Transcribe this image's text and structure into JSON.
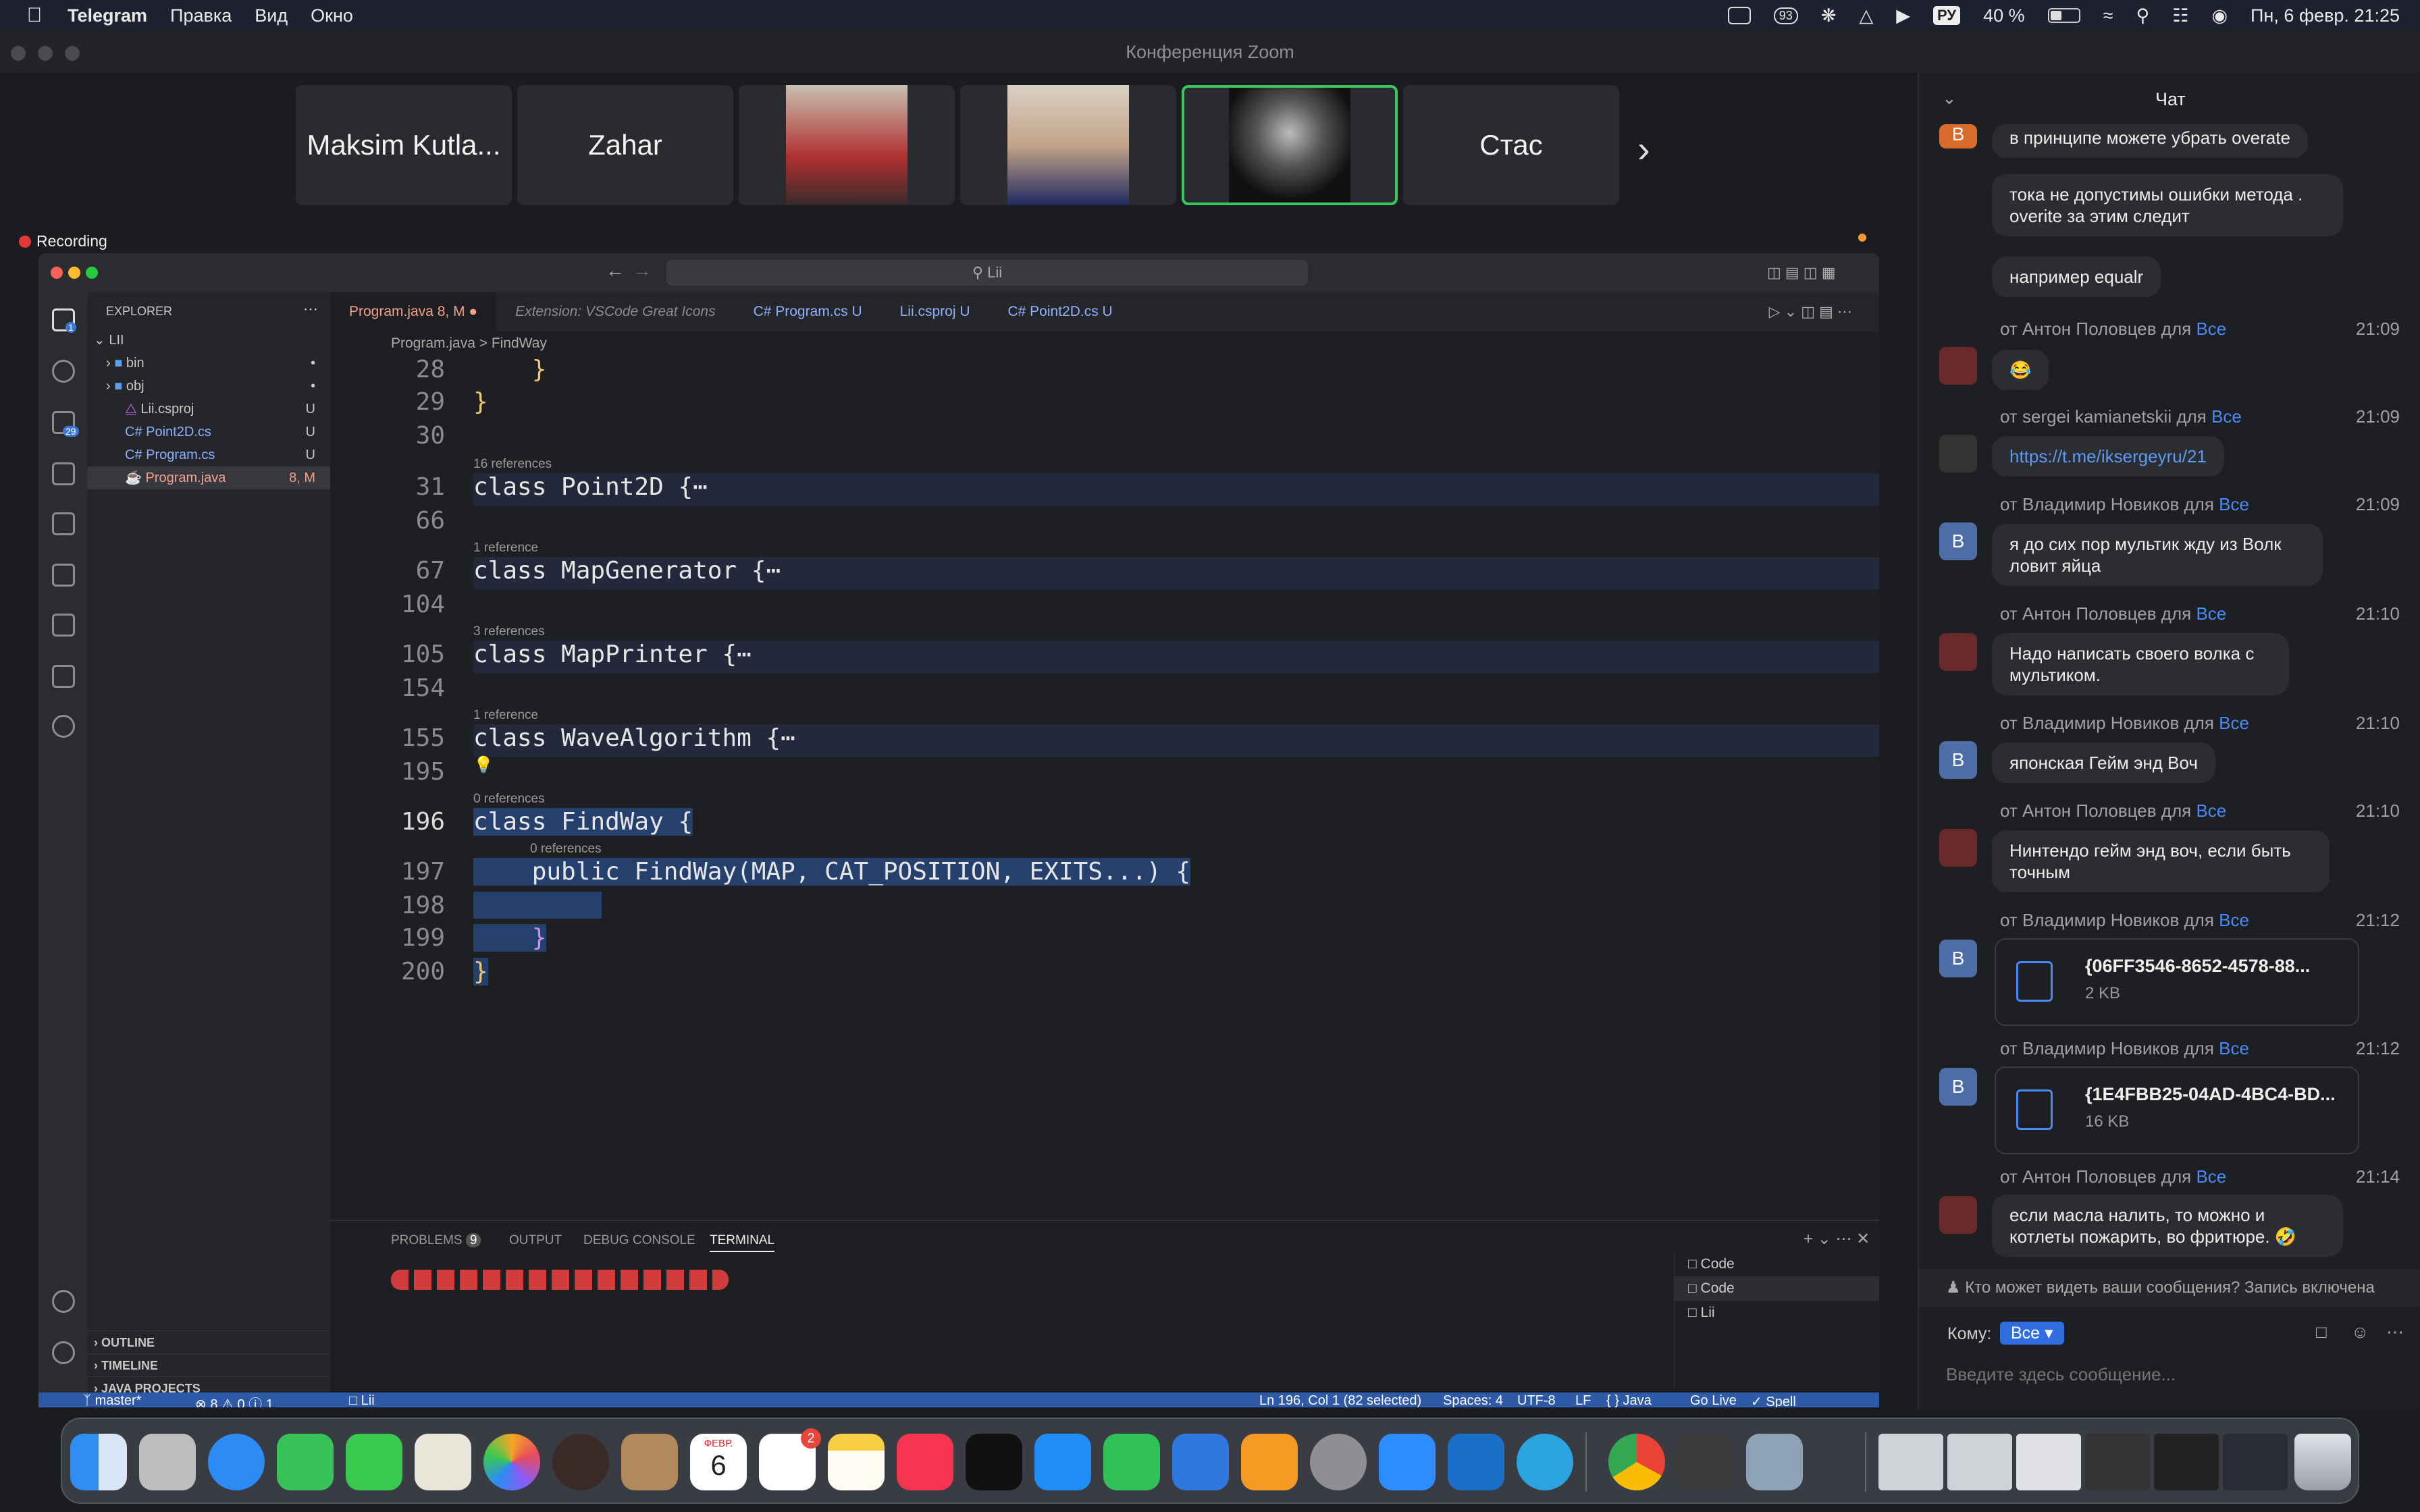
{
  "menubar": {
    "app": "Telegram",
    "items": [
      "Правка",
      "Вид",
      "Окно"
    ],
    "battery": "40 %",
    "lang": "РУ",
    "datetime": "Пн, 6 февр.  21:25",
    "badge": "93"
  },
  "zoom": {
    "title": "Конференция Zoom",
    "recording": "Recording",
    "participants": [
      "Maksim Kutla...",
      "Zahar",
      "",
      "",
      "",
      "Стас"
    ]
  },
  "vscode": {
    "search": "Lii",
    "explorer_title": "EXPLORER",
    "root": "LII",
    "files": [
      {
        "name": "bin",
        "status": "•"
      },
      {
        "name": "obj",
        "status": "•"
      },
      {
        "name": "Lii.csproj",
        "status": "U"
      },
      {
        "name": "Point2D.cs",
        "status": "U"
      },
      {
        "name": "Program.cs",
        "status": "U"
      },
      {
        "name": "Program.java",
        "status": "8, M"
      }
    ],
    "scm_badge": "29",
    "tabs": [
      {
        "label": "Program.java  8, M  ●"
      },
      {
        "label": "Extension: VSCode Great Icons"
      },
      {
        "label": "C# Program.cs  U"
      },
      {
        "label": "Lii.csproj  U"
      },
      {
        "label": "C# Point2D.cs  U"
      }
    ],
    "breadcrumb": "Program.java  >  FindWay",
    "lines": [
      {
        "n": "28",
        "code": "    }"
      },
      {
        "n": "29",
        "code": "}"
      },
      {
        "n": "30",
        "code": ""
      },
      {
        "n": "31",
        "refs": "16 references",
        "code": "class Point2D {⋯"
      },
      {
        "n": "66",
        "code": ""
      },
      {
        "n": "67",
        "refs": "1 reference",
        "code": "class MapGenerator {⋯"
      },
      {
        "n": "104",
        "code": ""
      },
      {
        "n": "105",
        "refs": "3 references",
        "code": "class MapPrinter {⋯"
      },
      {
        "n": "154",
        "code": ""
      },
      {
        "n": "155",
        "refs": "1 reference",
        "code": "class WaveAlgorithm {⋯"
      },
      {
        "n": "195",
        "code": ""
      },
      {
        "n": "196",
        "refs": "0 references",
        "code": "class FindWay {"
      },
      {
        "n": "197",
        "refs": "0 references",
        "code": "    public FindWay(MAP, CAT_POSITION, EXITS...) {"
      },
      {
        "n": "198",
        "code": ""
      },
      {
        "n": "199",
        "code": "    }"
      },
      {
        "n": "200",
        "code": "}"
      }
    ],
    "panel_tabs": [
      "PROBLEMS",
      "OUTPUT",
      "DEBUG CONSOLE",
      "TERMINAL"
    ],
    "problems_count": "9",
    "terminals": [
      "Code",
      "Code",
      "Lii"
    ],
    "outline": [
      "OUTLINE",
      "TIMELINE",
      "JAVA PROJECTS"
    ],
    "status": {
      "branch": "master*",
      "errors": "⊗ 8 ⚠ 0 ⓘ 1",
      "project": "Lii",
      "cursor": "Ln 196, Col 1 (82 selected)",
      "spaces": "Spaces: 4",
      "encoding": "UTF-8",
      "eol": "LF",
      "lang": "{ } Java",
      "golive": "Go Live",
      "spell": "✓ Spell"
    }
  },
  "chat": {
    "title": "Чат",
    "messages": [
      {
        "avatar": "В",
        "text": "в принципе можете убрать overate"
      },
      {
        "text": "тока не допустимы ошибки метода . overite за этим следит"
      },
      {
        "text": "например equalr"
      },
      {
        "from": "от Антон Половцев для",
        "to": "Все",
        "time": "21:09",
        "text": "😂"
      },
      {
        "from": "от sergei kamianetskii для",
        "to": "Все",
        "time": "21:09",
        "text": "https://t.me/iksergeyru/21"
      },
      {
        "from": "от Владимир Новиков для",
        "to": "Все",
        "time": "21:09",
        "avatar": "В",
        "text": "я до сих пор мультик жду из Волк ловит яйца"
      },
      {
        "from": "от Антон Половцев для",
        "to": "Все",
        "time": "21:10",
        "text": "Надо написать своего волка с мультиком."
      },
      {
        "from": "от Владимир Новиков для",
        "to": "Все",
        "time": "21:10",
        "avatar": "В",
        "text": "японская Гейм энд Воч"
      },
      {
        "from": "от Антон Половцев для",
        "to": "Все",
        "time": "21:10",
        "text": "Нинтендо гейм энд воч, если быть точным"
      },
      {
        "from": "от Владимир Новиков для",
        "to": "Все",
        "time": "21:12",
        "avatar": "В",
        "file": "{06FF3546-8652-4578-88...",
        "size": "2 KB"
      },
      {
        "from": "от Владимир Новиков для",
        "to": "Все",
        "time": "21:12",
        "avatar": "В",
        "file": "{1E4FBB25-04AD-4BC4-BD...",
        "size": "16 KB"
      },
      {
        "from": "от Антон Половцев для",
        "to": "Все",
        "time": "21:14",
        "text": "если масла налить, то можно и котлеты пожарить, во фритюре. 🤣"
      }
    ],
    "notice": "Кто может видеть ваши сообщения? Запись включена",
    "to_label": "Кому:",
    "to_value": "Все",
    "placeholder": "Введите здесь сообщение..."
  },
  "dock": {
    "calendar_month": "ФЕВР.",
    "calendar_day": "6",
    "reminders_badge": "2"
  }
}
